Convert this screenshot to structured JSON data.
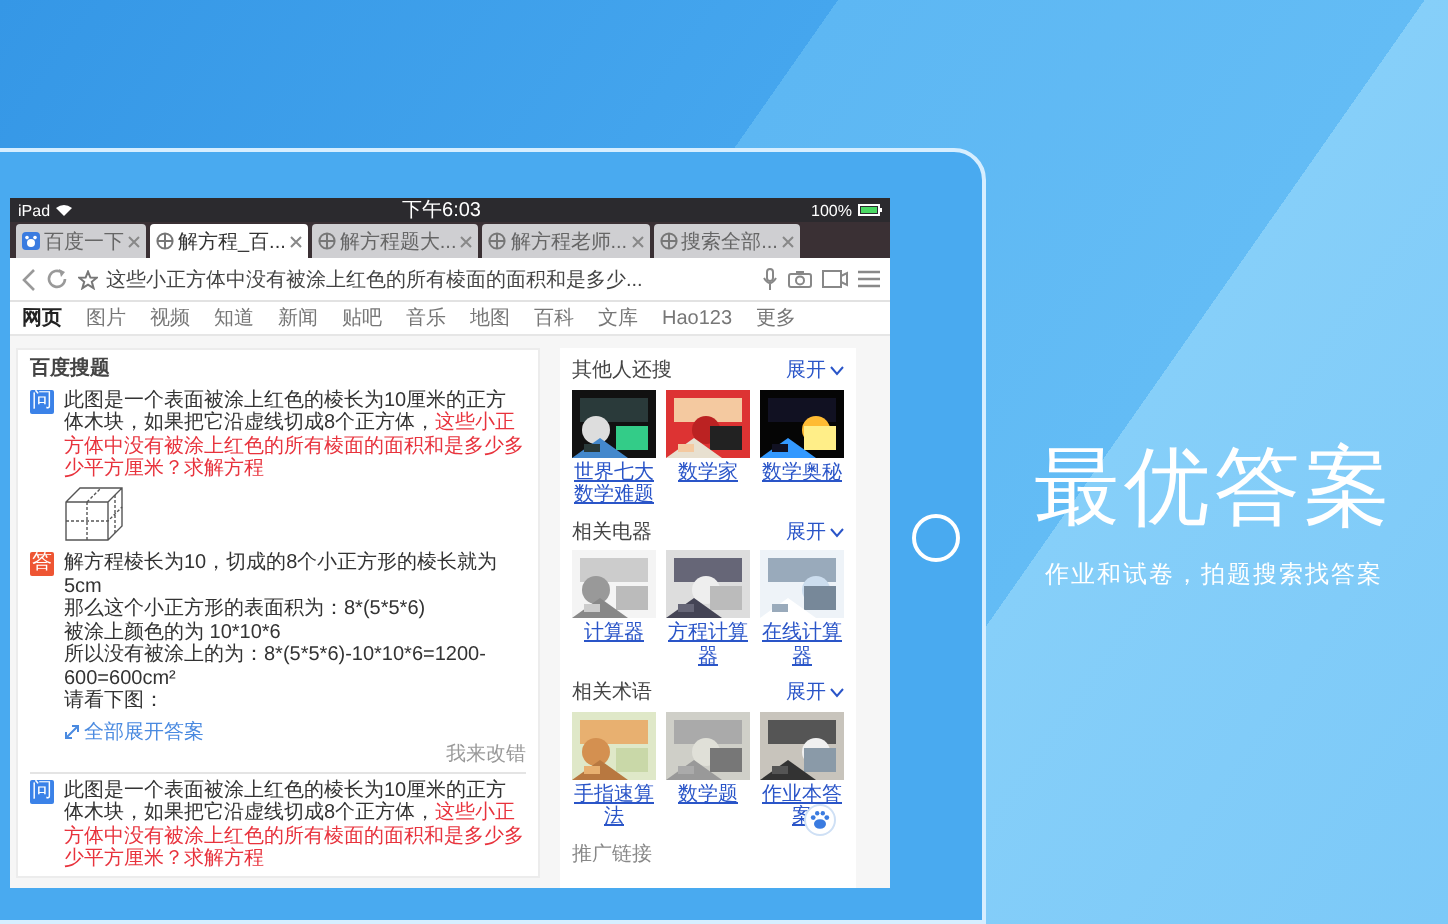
{
  "status_bar": {
    "device": "iPad",
    "time": "下午6:03",
    "battery": "100%"
  },
  "tabs": [
    {
      "label": "百度一下",
      "selected": false
    },
    {
      "label": "解方程_百...",
      "selected": true
    },
    {
      "label": "解方程题大...",
      "selected": false
    },
    {
      "label": "解方程老师...",
      "selected": false
    },
    {
      "label": "搜索全部...",
      "selected": false
    }
  ],
  "address_bar": {
    "value": "这些小正方体中没有被涂上红色的所有棱面的面积和是多少..."
  },
  "nav": [
    {
      "label": "网页",
      "selected": true
    },
    {
      "label": "图片",
      "selected": false
    },
    {
      "label": "视频",
      "selected": false
    },
    {
      "label": "知道",
      "selected": false
    },
    {
      "label": "新闻",
      "selected": false
    },
    {
      "label": "贴吧",
      "selected": false
    },
    {
      "label": "音乐",
      "selected": false
    },
    {
      "label": "地图",
      "selected": false
    },
    {
      "label": "百科",
      "selected": false
    },
    {
      "label": "文库",
      "selected": false
    },
    {
      "label": "Hao123",
      "selected": false
    },
    {
      "label": "更多",
      "selected": false
    }
  ],
  "result_card": {
    "title": "百度搜题",
    "question": {
      "badge": "问",
      "text": "此图是一个表面被涂上红色的棱长为10厘米的正方体木块，如果把它沿虚线切成8个正方体，",
      "highlight": "这些小正方体中没有被涂上红色的所有棱面的面积和是多少多少平方厘米？求解方程"
    },
    "answer": {
      "badge": "答",
      "lines": [
        "解方程棱长为10，切成的8个小正方形的棱长就为5cm",
        "那么这个小正方形的表面积为：8*(5*5*6)",
        "被涂上颜色的为 10*10*6",
        "所以没有被涂上的为：8*(5*5*6)-10*10*6=1200-600=600cm²",
        "请看下图："
      ]
    },
    "expand_link": "全部展开答案",
    "report_link": "我来改错",
    "next_question": {
      "badge": "问",
      "text": "此图是一个表面被涂上红色的棱长为10厘米的正方体木块，如果把它沿虚线切成8个正方体，",
      "highlight": "这些小正方体中没有被涂上红色的所有棱面的面积和是多少多少平方厘米？求解方程"
    }
  },
  "side_panel": {
    "sections": [
      {
        "title": "其他人还搜",
        "more": "展开",
        "items": [
          {
            "caption": "世界七大数学难题"
          },
          {
            "caption": "数学家"
          },
          {
            "caption": "数学奥秘"
          }
        ]
      },
      {
        "title": "相关电器",
        "more": "展开",
        "items": [
          {
            "caption": "计算器"
          },
          {
            "caption": "方程计算器"
          },
          {
            "caption": "在线计算器"
          }
        ]
      },
      {
        "title": "相关术语",
        "more": "展开",
        "items": [
          {
            "caption": "手指速算法"
          },
          {
            "caption": "数学题"
          },
          {
            "caption": "作业本答案"
          }
        ]
      }
    ],
    "footer": "推广链接"
  },
  "promo": {
    "headline": "最优答案",
    "tagline": "作业和试卷，拍题搜索找答案"
  }
}
